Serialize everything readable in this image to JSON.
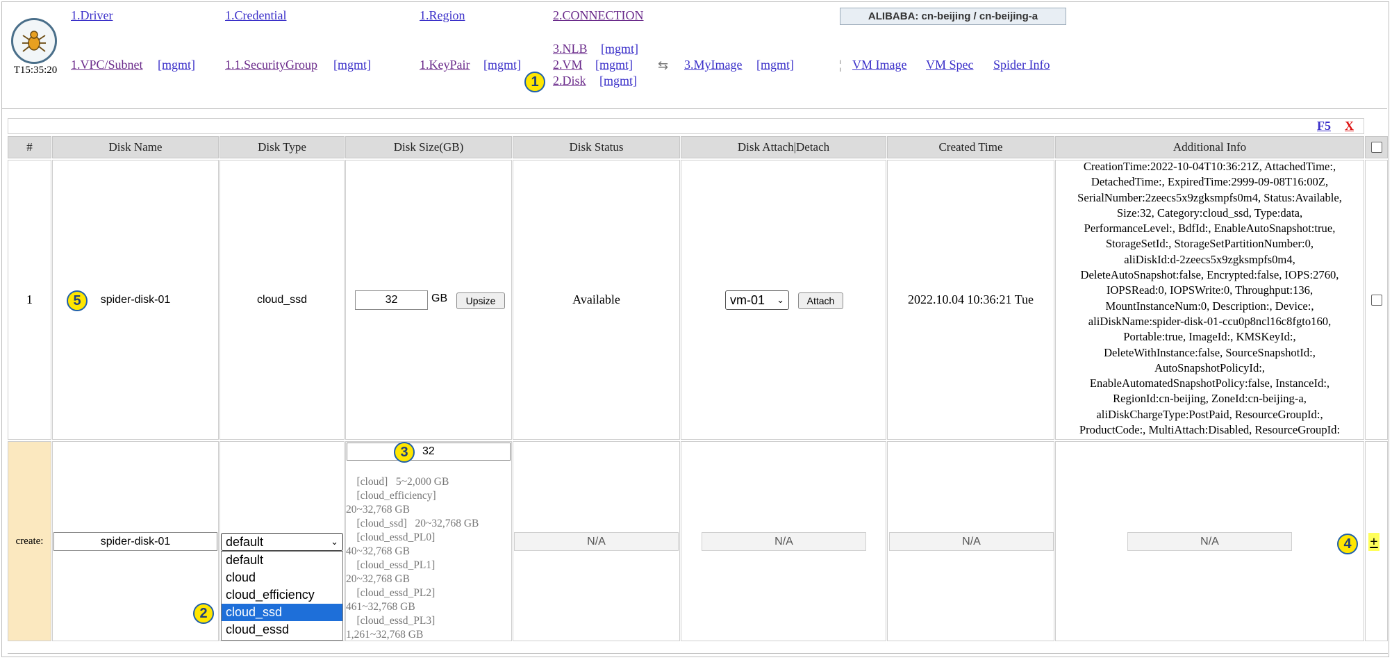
{
  "header": {
    "clock": "T15:35:20",
    "region_label": "ALIBABA: cn-beijing / cn-beijing-a",
    "row1": {
      "driver": "1.Driver",
      "credential": "1.Credential",
      "region": "1.Region",
      "connection": "2.CONNECTION"
    },
    "row2": {
      "vpc": "1.VPC/Subnet",
      "security_group": "1.1.SecurityGroup",
      "keypair": "1.KeyPair",
      "nlb": "3.NLB",
      "vm": "2.VM",
      "disk": "2.Disk",
      "myimage": "3.MyImage",
      "mgmt": "[mgmt]",
      "swap_icon": "⇆",
      "divider": "¦",
      "vm_image": "VM Image",
      "vm_spec": "VM Spec",
      "spider_info": "Spider Info"
    }
  },
  "toolbar": {
    "refresh": "F5",
    "close": "X"
  },
  "table": {
    "headers": [
      "#",
      "Disk Name",
      "Disk Type",
      "Disk Size(GB)",
      "Disk Status",
      "Disk Attach|Detach",
      "Created Time",
      "Additional Info"
    ],
    "row": {
      "index": "1",
      "name": "spider-disk-01",
      "type": "cloud_ssd",
      "size": "32",
      "size_unit": "GB",
      "upsize_label": "Upsize",
      "status": "Available",
      "vm_selected": "vm-01",
      "attach_label": "Attach",
      "created": "2022.10.04 10:36:21 Tue",
      "additional_info": [
        "CreationTime:2022-10-04T10:36:21Z, AttachedTime:,",
        "DetachedTime:, ExpiredTime:2999-09-08T16:00Z,",
        "SerialNumber:2zeecs5x9zgksmpfs0m4, Status:Available,",
        "Size:32, Category:cloud_ssd, Type:data,",
        "PerformanceLevel:, BdfId:, EnableAutoSnapshot:true,",
        "StorageSetId:, StorageSetPartitionNumber:0,",
        "aliDiskId:d-2zeecs5x9zgksmpfs0m4,",
        "DeleteAutoSnapshot:false, Encrypted:false, IOPS:2760,",
        "IOPSRead:0, IOPSWrite:0, Throughput:136,",
        "MountInstanceNum:0, Description:, Device:,",
        "aliDiskName:spider-disk-01-ccu0p8ncl16c8fgto160,",
        "Portable:true, ImageId:, KMSKeyId:,",
        "DeleteWithInstance:false, SourceSnapshotId:,",
        "AutoSnapshotPolicyId:,",
        "EnableAutomatedSnapshotPolicy:false, InstanceId:,",
        "RegionId:cn-beijing, ZoneId:cn-beijing-a,",
        "aliDiskChargeType:PostPaid, ResourceGroupId:,",
        "ProductCode:, MultiAttach:Disabled, ResourceGroupId:"
      ]
    },
    "create": {
      "label": "create:",
      "name_value": "spider-disk-01",
      "type_selected": "default",
      "type_options": [
        "default",
        "cloud",
        "cloud_efficiency",
        "cloud_ssd",
        "cloud_essd"
      ],
      "highlighted_option": "cloud_ssd",
      "size_value": "32",
      "size_hints": [
        "    [cloud]   5~2,000 GB",
        "    [cloud_efficiency]",
        "20~32,768 GB",
        "    [cloud_ssd]   20~32,768 GB",
        "    [cloud_essd_PL0]",
        "40~32,768 GB",
        "    [cloud_essd_PL1]",
        "20~32,768 GB",
        "    [cloud_essd_PL2]",
        "461~32,768 GB",
        "    [cloud_essd_PL3]",
        "1,261~32,768 GB"
      ],
      "na": "N/A",
      "add_label": "+"
    }
  },
  "badges": [
    "1",
    "2",
    "3",
    "4",
    "5"
  ]
}
